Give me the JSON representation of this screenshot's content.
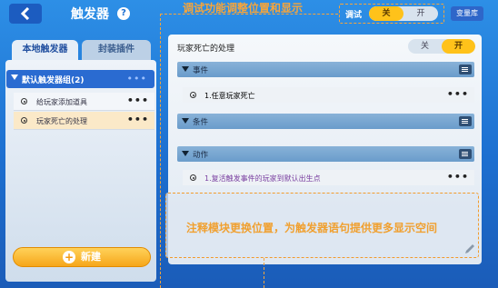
{
  "header": {
    "title": "触发器",
    "help_glyph": "?",
    "annotation": "调试功能调整位置和显示",
    "debug_label": "调试",
    "debug_toggle": {
      "off": "关",
      "on": "开",
      "selected": "off"
    },
    "vault_button": "变量库"
  },
  "tabs": [
    {
      "label": "本地触发器",
      "active": true
    },
    {
      "label": "封装插件",
      "active": false
    }
  ],
  "trigger_group": {
    "label": "默认触发器组(2)",
    "more": "•••"
  },
  "triggers": [
    {
      "label": "给玩家添加道具",
      "more": "•••",
      "selected": false
    },
    {
      "label": "玩家死亡的处理",
      "more": "•••",
      "selected": true
    }
  ],
  "new_button": {
    "label": "新建",
    "plus": "+"
  },
  "handler": {
    "title": "玩家死亡的处理",
    "toggle": {
      "off": "关",
      "on": "开",
      "selected": "on"
    }
  },
  "sections": {
    "event": {
      "label": "事件",
      "items": [
        {
          "text": "1.任意玩家死亡",
          "more": "•••"
        }
      ]
    },
    "condition": {
      "label": "条件"
    },
    "action": {
      "label": "动作",
      "items": [
        {
          "text": "1.复活触发事件的玩家到默认出生点",
          "more": "•••"
        }
      ]
    }
  },
  "note": {
    "text": "注释模块更换位置，为触发器语句提供更多显示空间"
  },
  "colors": {
    "accent": "#ffc21a",
    "annotation": "#f7a53a",
    "primary": "#2a6bd1"
  }
}
